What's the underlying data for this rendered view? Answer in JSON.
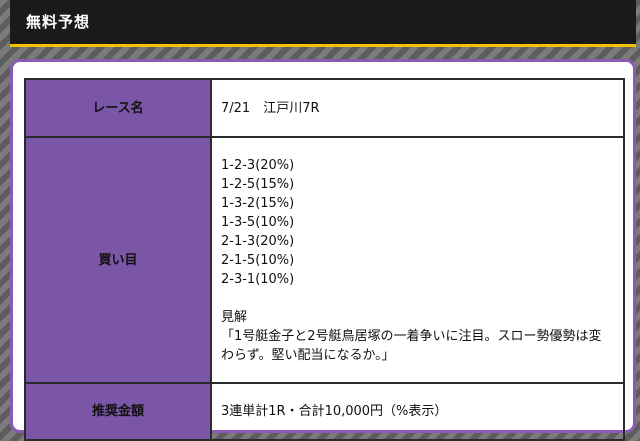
{
  "header": {
    "title": "無料予想"
  },
  "table": {
    "race": {
      "label": "レース名",
      "value": "7/21　江戸川7R"
    },
    "bets": {
      "label": "買い目",
      "items": [
        "1-2-3(20%)",
        "1-2-5(15%)",
        "1-3-2(15%)",
        "1-3-5(10%)",
        "2-1-3(20%)",
        "2-1-5(10%)",
        "2-3-1(10%)"
      ],
      "opinion_title": "見解",
      "opinion_text": "「1号艇金子と2号艇鳥居塚の一着争いに注目。スロー勢優勢は変わらず。堅い配当になるか。」"
    },
    "amount": {
      "label": "推奨金額",
      "value": "3連単計1R・合計10,000円（%表示）"
    }
  },
  "colors": {
    "accent": "#f2c400",
    "label_bg": "#7b55a6",
    "card_border": "#8a5bb5",
    "header_bg": "#1a1a1a"
  }
}
